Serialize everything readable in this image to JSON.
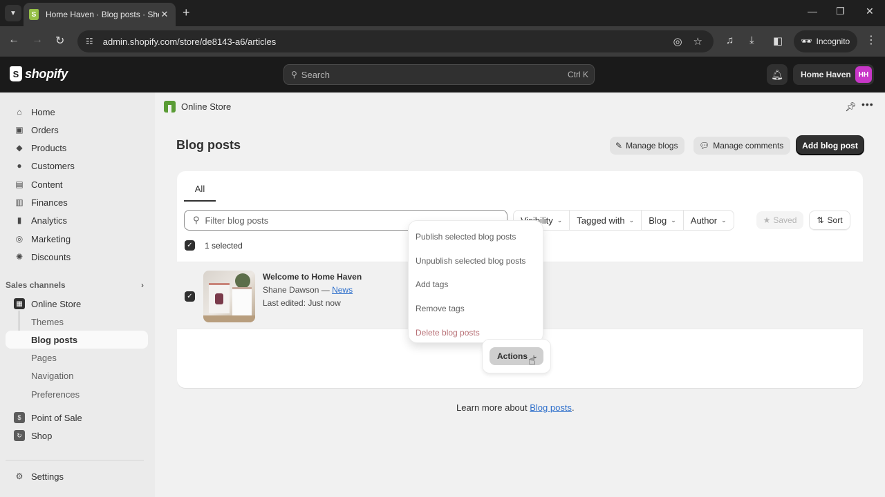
{
  "browser": {
    "tab_title": "Home Haven · Blog posts · Shopify",
    "url": "admin.shopify.com/store/de8143-a6/articles",
    "profile_label": "Incognito"
  },
  "topbar": {
    "brand": "shopify",
    "search_placeholder": "Search",
    "search_shortcut": "Ctrl K",
    "store_name": "Home Haven",
    "avatar_initials": "HH",
    "avatar_color": "#c837c8"
  },
  "sidebar": {
    "items": [
      {
        "label": "Home",
        "icon": "home-icon"
      },
      {
        "label": "Orders",
        "icon": "inbox-icon"
      },
      {
        "label": "Products",
        "icon": "tag-icon"
      },
      {
        "label": "Customers",
        "icon": "person-icon"
      },
      {
        "label": "Content",
        "icon": "image-icon"
      },
      {
        "label": "Finances",
        "icon": "bank-icon"
      },
      {
        "label": "Analytics",
        "icon": "bar-chart-icon"
      },
      {
        "label": "Marketing",
        "icon": "target-icon"
      },
      {
        "label": "Discounts",
        "icon": "discount-icon"
      }
    ],
    "sales_channels_label": "Sales channels",
    "online_store": {
      "label": "Online Store",
      "sub_items": [
        "Themes",
        "Blog posts",
        "Pages",
        "Navigation",
        "Preferences"
      ],
      "active_sub": "Blog posts"
    },
    "other_channels": [
      {
        "label": "Point of Sale",
        "icon": "pos-icon"
      },
      {
        "label": "Shop",
        "icon": "shop-icon"
      }
    ],
    "settings_label": "Settings"
  },
  "main": {
    "breadcrumb": "Online Store",
    "page_title": "Blog posts",
    "header_buttons": {
      "manage_blogs": "Manage blogs",
      "manage_comments": "Manage comments",
      "add_blog_post": "Add blog post"
    },
    "tabs": [
      {
        "label": "All",
        "selected": true
      }
    ],
    "filter_placeholder": "Filter blog posts",
    "filters": [
      "Visibility",
      "Tagged with",
      "Blog",
      "Author"
    ],
    "saved_label": "Saved",
    "sort_label": "Sort",
    "selection_text": "1 selected",
    "posts": [
      {
        "title": "Welcome to Home Haven",
        "author": "Shane Dawson",
        "separator": "—",
        "blog": "News",
        "last_edited": "Last edited: Just now",
        "selected": true
      }
    ],
    "bulk_actions": {
      "button_label": "Actions",
      "menu_items": [
        {
          "label": "Publish selected blog posts",
          "destructive": false
        },
        {
          "label": "Unpublish selected blog posts",
          "destructive": false
        },
        {
          "label": "Add tags",
          "destructive": false
        },
        {
          "label": "Remove tags",
          "destructive": false
        },
        {
          "label": "Delete blog posts",
          "destructive": true
        }
      ]
    },
    "footer": {
      "prefix": "Learn more about ",
      "link": "Blog posts",
      "suffix": "."
    }
  }
}
